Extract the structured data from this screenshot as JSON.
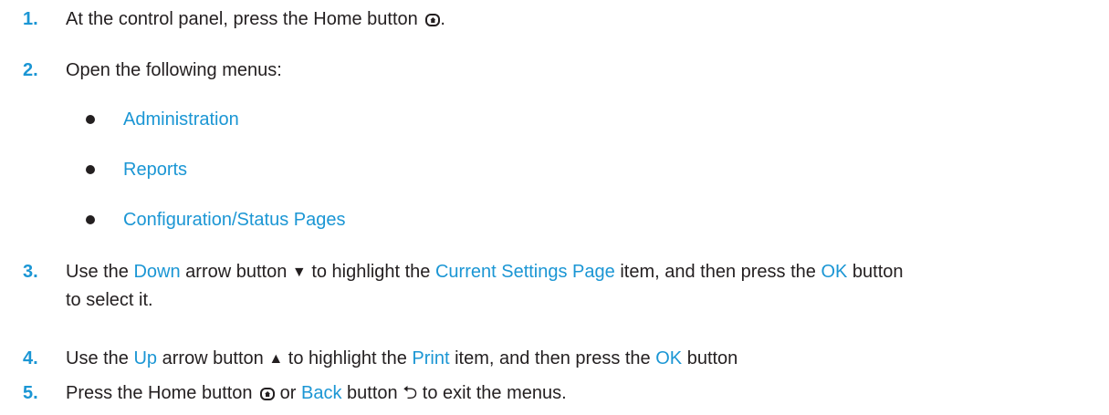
{
  "steps": [
    {
      "num": "1.",
      "parts": [
        "At the control panel, press the Home button ",
        "."
      ]
    },
    {
      "num": "2.",
      "text": "Open the following menus:"
    },
    {
      "num": "3.",
      "parts": [
        "Use the ",
        "Down",
        " arrow button ",
        " to highlight the ",
        "Current Settings Page",
        " item, and then press the ",
        "OK",
        " button",
        "to select it."
      ]
    },
    {
      "num": "4.",
      "parts": [
        "Use the ",
        "Up",
        " arrow button ",
        " to highlight the ",
        "Print",
        " item, and then press the ",
        "OK",
        " button"
      ]
    },
    {
      "num": "5.",
      "parts": [
        "Press the Home button ",
        " or ",
        "Back",
        " button ",
        " to exit the menus."
      ]
    }
  ],
  "menus": [
    "Administration",
    "Reports",
    "Configuration/Status Pages"
  ],
  "icons": {
    "home": "home-icon",
    "down": "▼",
    "up": "▲",
    "back": "⮌"
  },
  "colors": {
    "accent": "#1b96d4",
    "text": "#231f20"
  }
}
